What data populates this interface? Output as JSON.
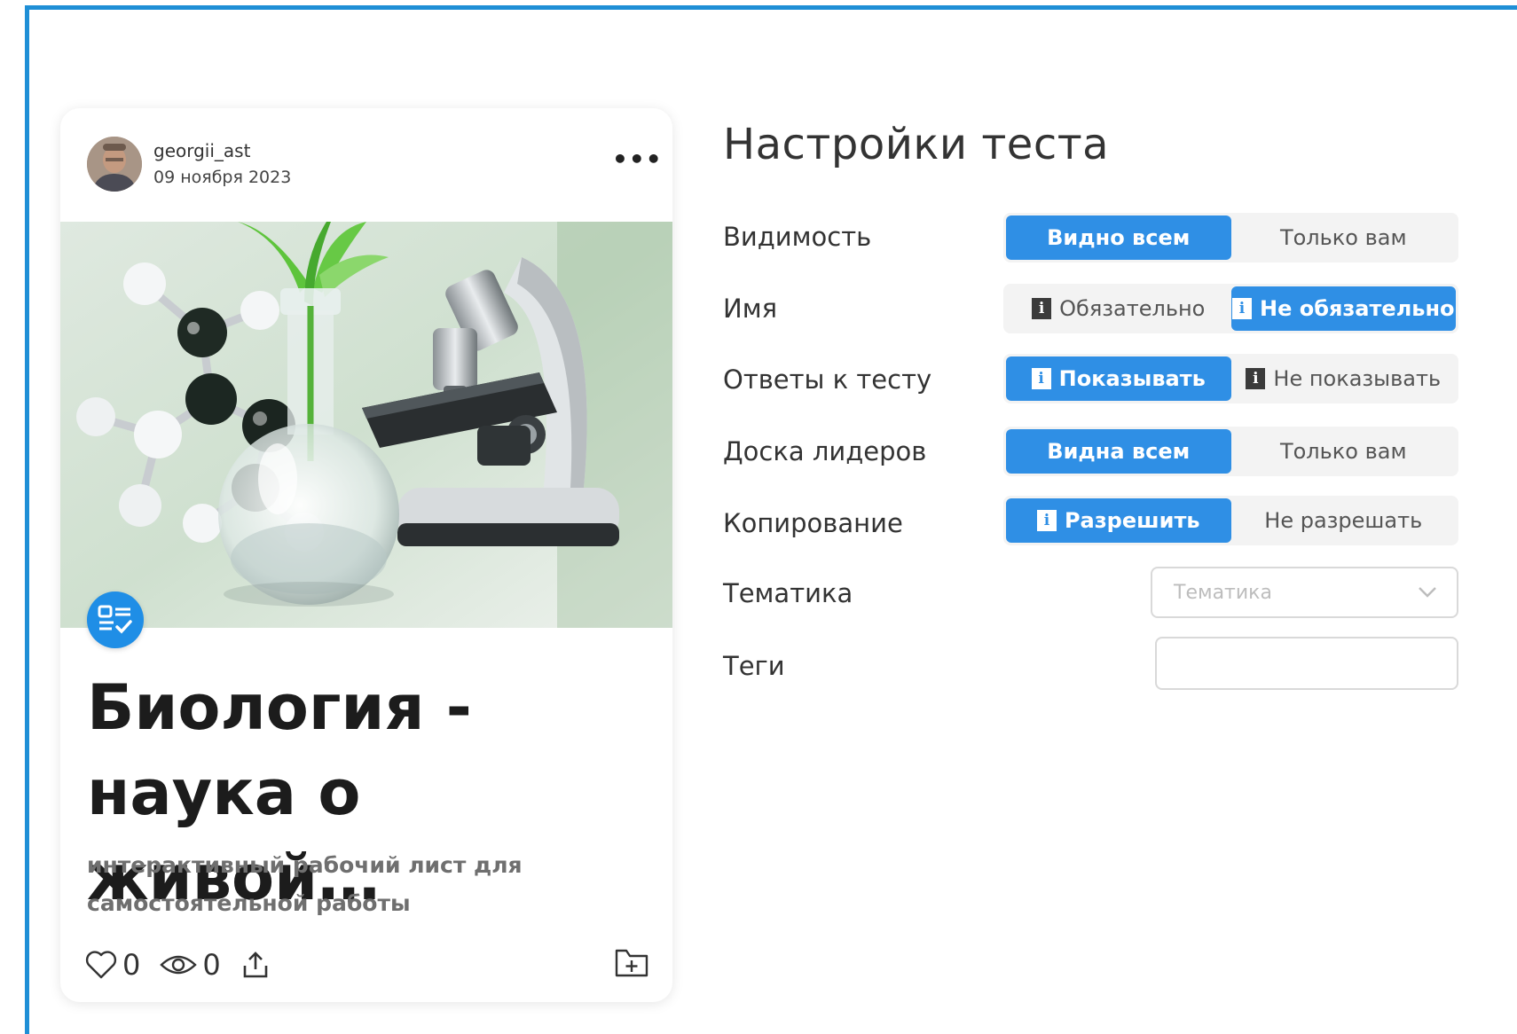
{
  "card": {
    "username": "georgii_ast",
    "date": "09 ноября 2023",
    "more_label": "•••",
    "title_line1": "Биология -",
    "title_line2": "наука о живой…",
    "subtitle_line1": "интерактивный рабочий лист для",
    "subtitle_line2": "самостоятельной работы",
    "likes": "0",
    "views": "0",
    "icons": [
      "heart-icon",
      "eye-icon",
      "share-icon",
      "add-to-folder-icon",
      "worksheet-icon",
      "more-icon"
    ]
  },
  "settings": {
    "title": "Настройки теста",
    "rows": [
      {
        "label": "Видимость",
        "options": [
          "Видно всем",
          "Только вам"
        ],
        "selected": 0
      },
      {
        "label": "Имя",
        "options": [
          "Обязательно",
          "Не обязательно"
        ],
        "selected": 1
      },
      {
        "label": "Ответы к тесту",
        "options": [
          "Показывать",
          "Не показывать"
        ],
        "selected": 0
      },
      {
        "label": "Доска лидеров",
        "options": [
          "Видна всем",
          "Только вам"
        ],
        "selected": 0
      },
      {
        "label": "Копирование",
        "options": [
          "Разрешить",
          "Не разрешать"
        ],
        "selected": 0
      }
    ],
    "topic_label": "Тематика",
    "topic_placeholder": "Тематика",
    "tags_label": "Теги",
    "tags_value": ""
  },
  "colors": {
    "accent": "#2f8fe5",
    "frame": "#1f8fd6",
    "segment_bg": "#f3f3f3"
  }
}
